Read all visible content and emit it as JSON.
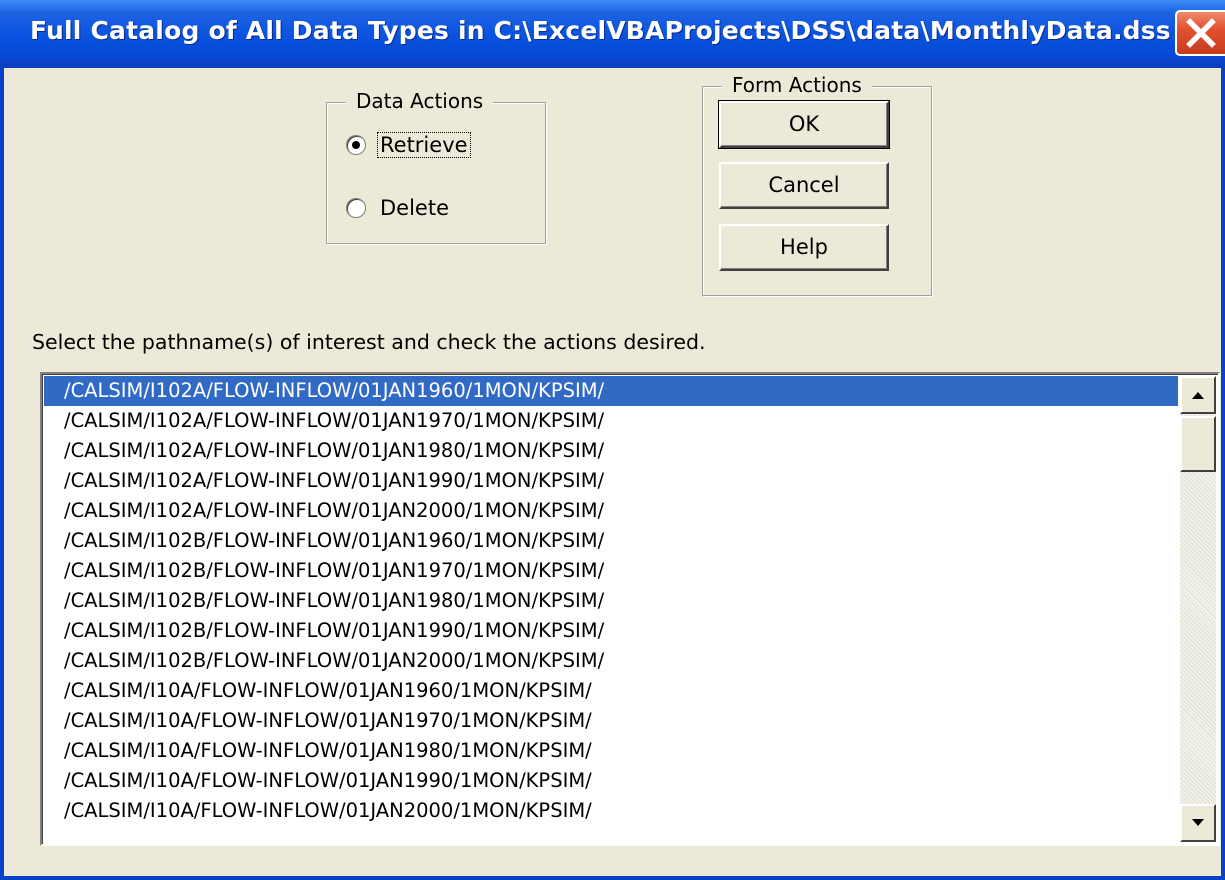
{
  "window": {
    "title": "Full Catalog of All Data Types in C:\\ExcelVBAProjects\\DSS\\data\\MonthlyData.dss"
  },
  "data_actions": {
    "label": "Data Actions",
    "options": [
      {
        "label": "Retrieve",
        "checked": true
      },
      {
        "label": "Delete",
        "checked": false
      }
    ]
  },
  "form_actions": {
    "label": "Form Actions",
    "ok_label": "OK",
    "cancel_label": "Cancel",
    "help_label": "Help"
  },
  "instruction": "Select the pathname(s) of interest and check the actions desired.",
  "pathnames": {
    "selected_index": 0,
    "items": [
      "/CALSIM/I102A/FLOW-INFLOW/01JAN1960/1MON/KPSIM/",
      "/CALSIM/I102A/FLOW-INFLOW/01JAN1970/1MON/KPSIM/",
      "/CALSIM/I102A/FLOW-INFLOW/01JAN1980/1MON/KPSIM/",
      "/CALSIM/I102A/FLOW-INFLOW/01JAN1990/1MON/KPSIM/",
      "/CALSIM/I102A/FLOW-INFLOW/01JAN2000/1MON/KPSIM/",
      "/CALSIM/I102B/FLOW-INFLOW/01JAN1960/1MON/KPSIM/",
      "/CALSIM/I102B/FLOW-INFLOW/01JAN1970/1MON/KPSIM/",
      "/CALSIM/I102B/FLOW-INFLOW/01JAN1980/1MON/KPSIM/",
      "/CALSIM/I102B/FLOW-INFLOW/01JAN1990/1MON/KPSIM/",
      "/CALSIM/I102B/FLOW-INFLOW/01JAN2000/1MON/KPSIM/",
      "/CALSIM/I10A/FLOW-INFLOW/01JAN1960/1MON/KPSIM/",
      "/CALSIM/I10A/FLOW-INFLOW/01JAN1970/1MON/KPSIM/",
      "/CALSIM/I10A/FLOW-INFLOW/01JAN1980/1MON/KPSIM/",
      "/CALSIM/I10A/FLOW-INFLOW/01JAN1990/1MON/KPSIM/",
      "/CALSIM/I10A/FLOW-INFLOW/01JAN2000/1MON/KPSIM/"
    ]
  },
  "colors": {
    "titlebar": "#0a54e0",
    "dialog_bg": "#ece9d8",
    "selection": "#316ac5",
    "close_button": "#e2522f"
  },
  "icons": {
    "close": "close-icon",
    "scroll_up": "arrow-up-icon",
    "scroll_down": "arrow-down-icon"
  }
}
